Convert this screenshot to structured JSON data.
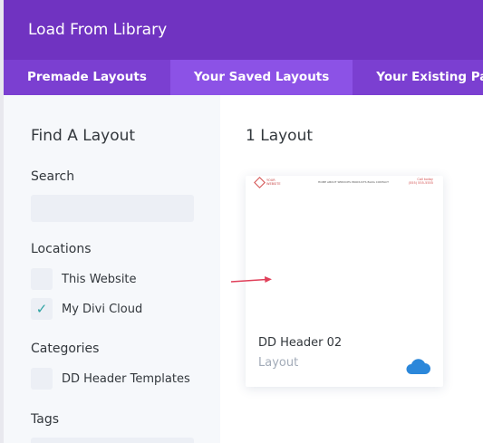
{
  "modal": {
    "title": "Load From Library"
  },
  "tabs": [
    {
      "label": "Premade Layouts",
      "active": false
    },
    {
      "label": "Your Saved Layouts",
      "active": true
    },
    {
      "label": "Your Existing Pages",
      "active": false
    }
  ],
  "sidebar": {
    "heading": "Find A Layout",
    "search_label": "Search",
    "search_value": "",
    "locations_label": "Locations",
    "locations": [
      {
        "label": "This Website",
        "checked": false
      },
      {
        "label": "My Divi Cloud",
        "checked": true
      }
    ],
    "categories_label": "Categories",
    "categories": [
      {
        "label": "DD Header Templates",
        "checked": false
      }
    ],
    "tags_label": "Tags"
  },
  "results": {
    "count_label": "1 Layout",
    "cards": [
      {
        "title": "DD Header 02",
        "subtitle": "Layout",
        "icon": "cloud-icon",
        "thumb": {
          "logo_text_1": "YOUR",
          "logo_text_2": "WEBSITE",
          "nav_text": "HOME  ABOUT  SERVICES  PRODUCTS  BLOG  CONTACT",
          "phone_label": "Call today",
          "phone": "(555) 555-5555"
        }
      }
    ]
  },
  "colors": {
    "header": "#7033c1",
    "tabs": "#7b3fd1",
    "active_tab": "#8c52e6",
    "check": "#2ea3a3",
    "cloud": "#2b87da",
    "arrow": "#e0405a"
  }
}
